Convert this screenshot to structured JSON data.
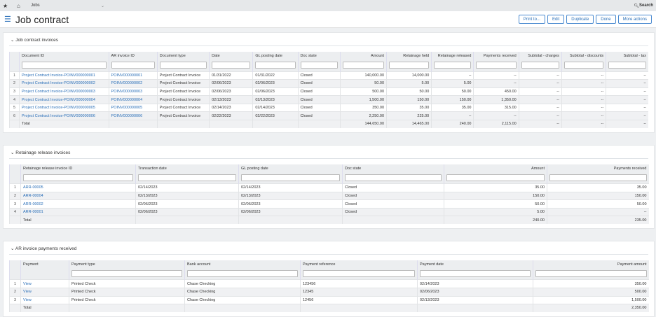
{
  "topbar": {
    "app": "Jobs",
    "search": "Search"
  },
  "title": "Job contract",
  "actions": [
    "Print to...",
    "Edit",
    "Duplicate",
    "Done",
    "More actions"
  ],
  "sections": [
    {
      "title": "Job contract invoices",
      "widths": [
        14,
        127,
        69,
        74,
        62,
        64,
        60,
        66,
        64,
        60,
        64,
        61,
        63,
        60
      ],
      "columns": [
        {
          "label": "Document ID"
        },
        {
          "label": "AR invoice ID"
        },
        {
          "label": "Document type"
        },
        {
          "label": "Date"
        },
        {
          "label": "GL posting date"
        },
        {
          "label": "Doc state"
        },
        {
          "label": "Amount",
          "right": true
        },
        {
          "label": "Retainage held",
          "right": true
        },
        {
          "label": "Retainage released",
          "right": true
        },
        {
          "label": "Payments received",
          "right": true
        },
        {
          "label": "Subtotal - charges",
          "right": true
        },
        {
          "label": "Subtotal - discounts",
          "right": true
        },
        {
          "label": "Subtotal - tax",
          "right": true
        }
      ],
      "links": [
        0,
        1
      ],
      "rows": [
        [
          "Project Contract Invoice-POINV000000001",
          "POINV000000001",
          "Project Contract Invoice",
          "01/31/2022",
          "01/31/2022",
          "Closed",
          "140,000.00",
          "14,000.00",
          "--",
          "--",
          "--",
          "--",
          "--"
        ],
        [
          "Project Contract Invoice-POINV000000002",
          "POINV000000002",
          "Project Contract Invoice",
          "02/06/2023",
          "02/06/2023",
          "Closed",
          "50.00",
          "5.00",
          "5.00",
          "--",
          "--",
          "--",
          "--"
        ],
        [
          "Project Contract Invoice-POINV000000003",
          "POINV000000003",
          "Project Contract Invoice",
          "02/06/2023",
          "02/06/2023",
          "Closed",
          "500.00",
          "50.00",
          "50.00",
          "450.00",
          "--",
          "--",
          "--"
        ],
        [
          "Project Contract Invoice-POINV000000004",
          "POINV000000004",
          "Project Contract Invoice",
          "02/13/2023",
          "02/13/2023",
          "Closed",
          "1,500.00",
          "150.00",
          "150.00",
          "1,350.00",
          "--",
          "--",
          "--"
        ],
        [
          "Project Contract Invoice-POINV000000005",
          "POINV000000005",
          "Project Contract Invoice",
          "02/14/2023",
          "02/14/2023",
          "Closed",
          "350.00",
          "35.00",
          "35.00",
          "315.00",
          "--",
          "--",
          "--"
        ],
        [
          "Project Contract Invoice-POINV000000006",
          "POINV000000006",
          "Project Contract Invoice",
          "02/22/2023",
          "02/22/2023",
          "Closed",
          "2,250.00",
          "225.00",
          "--",
          "--",
          "--",
          "--",
          "--"
        ]
      ],
      "total": [
        "Total",
        "",
        "",
        "",
        "",
        "",
        "144,650.00",
        "14,465.00",
        "240.00",
        "2,115.00",
        "--",
        "--",
        "--"
      ]
    },
    {
      "title": "Retainage release invoices",
      "widths": [
        16,
        164,
        147,
        148,
        145,
        147,
        145
      ],
      "columns": [
        {
          "label": "Retainage release invoice ID"
        },
        {
          "label": "Transaction date"
        },
        {
          "label": "GL posting date"
        },
        {
          "label": "Doc state"
        },
        {
          "label": "Amount",
          "right": true
        },
        {
          "label": "Payments received",
          "right": true
        }
      ],
      "links": [
        0
      ],
      "rows": [
        [
          "ARR-00005",
          "02/14/2023",
          "02/14/2023",
          "Closed",
          "35.00",
          "35.00"
        ],
        [
          "ARR-00004",
          "02/13/2023",
          "02/13/2023",
          "Closed",
          "150.00",
          "150.00"
        ],
        [
          "ARR-00002",
          "02/06/2023",
          "02/06/2023",
          "Closed",
          "50.00",
          "50.00"
        ],
        [
          "ARR-00001",
          "02/06/2023",
          "02/06/2023",
          "Closed",
          "5.00",
          "--"
        ]
      ],
      "total": [
        "Total",
        "",
        "",
        "",
        "240.00",
        "235.00"
      ]
    },
    {
      "title": "AR invoice payments received",
      "widths": [
        16,
        69,
        165,
        165,
        167,
        165,
        165
      ],
      "columns": [
        {
          "label": "Payment",
          "nofilter": true
        },
        {
          "label": "Payment type"
        },
        {
          "label": "Bank account"
        },
        {
          "label": "Payment reference"
        },
        {
          "label": "Payment date"
        },
        {
          "label": "Payment amount",
          "right": true
        }
      ],
      "links": [
        0
      ],
      "rows": [
        [
          "View",
          "Printed Check",
          "Chase Checking",
          "123456",
          "02/14/2023",
          "350.00"
        ],
        [
          "View",
          "Printed Check",
          "Chase Checking",
          "12345",
          "02/06/2023",
          "500.00"
        ],
        [
          "View",
          "Printed Check",
          "Chase Checking",
          "12456",
          "02/13/2023",
          "1,500.00"
        ]
      ],
      "total": [
        "Total",
        "",
        "",
        "",
        "",
        "2,350.00"
      ]
    }
  ]
}
